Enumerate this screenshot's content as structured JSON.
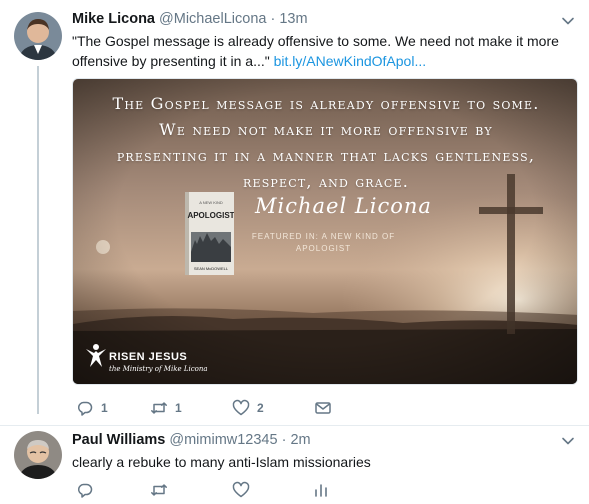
{
  "tweets": [
    {
      "name": "Mike Licona",
      "handle": "@MichaelLicona",
      "separator": "·",
      "time": "13m",
      "text": "\"The Gospel message is already offensive to some. We need not make it more offensive by presenting it in a...\"",
      "link": "bit.ly/ANewKindOfApol...",
      "media": {
        "quote_lines": [
          "The Gospel message is already offensive to some.",
          "We need not make it more offensive by",
          "presenting it in a manner that lacks gentleness,",
          "respect, and grace."
        ],
        "signature": "Michael Licona",
        "featured": "FEATURED IN: A NEW KIND OF APOLOGIST",
        "book_title": "APOLOGIST",
        "book_kicker": "A NEW KIND",
        "book_author": "SEAN McDOWELL",
        "brand_name": "RISEN JESUS",
        "brand_sub": "the Ministry of Mike Licona"
      },
      "actions": {
        "reply": "1",
        "retweet": "1",
        "like": "2"
      }
    },
    {
      "name": "Paul Williams",
      "handle": "@mimimw12345",
      "separator": "·",
      "time": "2m",
      "text": "clearly a rebuke to many anti-Islam missionaries",
      "actions": {
        "reply": "",
        "retweet": "",
        "like": ""
      }
    }
  ],
  "icons": {
    "reply": "reply-icon",
    "retweet": "retweet-icon",
    "like": "heart-icon",
    "dm": "envelope-icon",
    "analytics": "bar-chart-icon",
    "caret": "chevron-down-icon"
  },
  "colors": {
    "link": "#1b95e0",
    "muted": "#657786",
    "thread_line": "#c4cfd6"
  }
}
